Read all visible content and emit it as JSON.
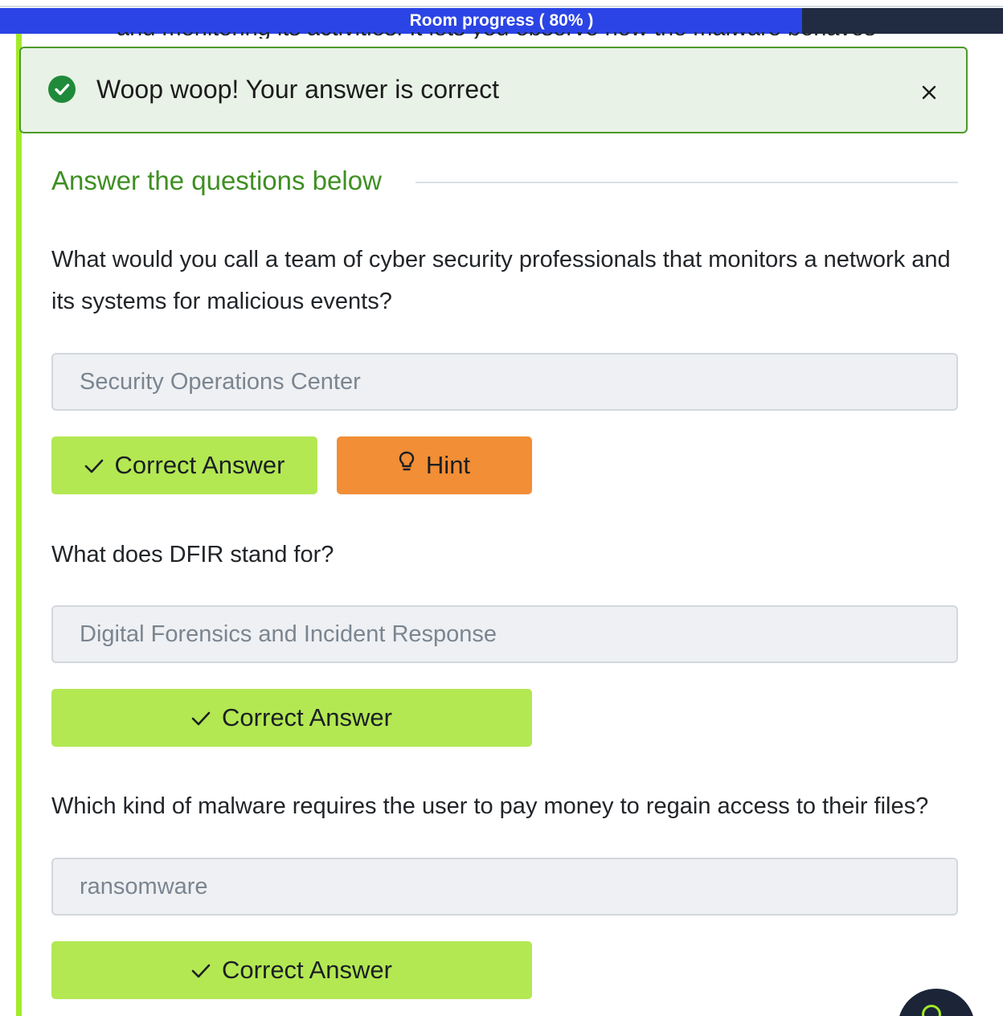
{
  "progress": {
    "label": "Room progress ( 80% )",
    "percent": 80,
    "fill_color": "#2b44e5",
    "track_color": "#212c42"
  },
  "clipped_text": "and monitoring its activities. It lets you observe how the malware behaves",
  "alert": {
    "message": "Woop woop! Your answer is correct",
    "icon": "check-circle-icon",
    "close_icon": "close-icon",
    "status_color": "#1f8a3a"
  },
  "section": {
    "heading": "Answer the questions below",
    "heading_color": "#3f8f23"
  },
  "questions": [
    {
      "text": "What would you call a team of cyber security professionals that monitors a network and its systems for malicious events?",
      "answer": "Security Operations Center",
      "submit_label": "Correct Answer",
      "hint_label": "Hint"
    },
    {
      "text": "What does DFIR stand for?",
      "answer": "Digital Forensics and Incident Response",
      "submit_label": "Correct Answer"
    },
    {
      "text": "Which kind of malware requires the user to pay money to regain access to their files?",
      "answer": "ransomware",
      "submit_label": "Correct Answer"
    }
  ],
  "colors": {
    "correct_button": "#b3e853",
    "hint_button": "#f18e36",
    "accent_rail": "#a3ea2a"
  }
}
